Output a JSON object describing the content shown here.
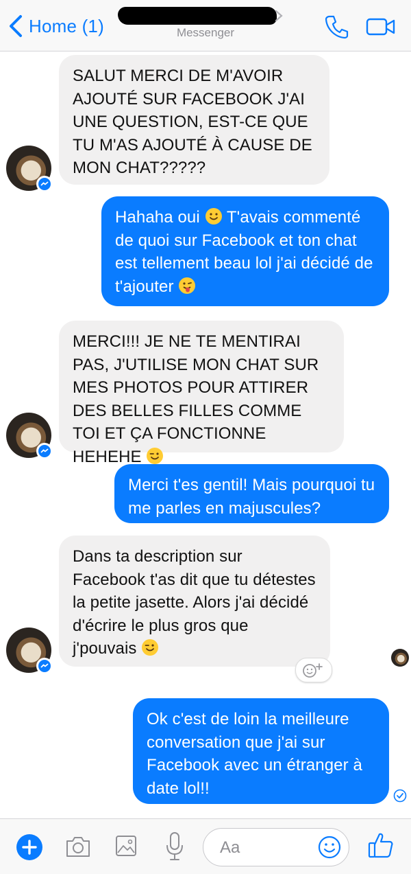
{
  "header": {
    "back_label": "Home (1)",
    "subtitle": "Messenger",
    "accent_color": "#0a7cff",
    "icons": [
      "chevron-left-icon",
      "phone-icon",
      "video-camera-icon"
    ]
  },
  "messages": [
    {
      "direction": "incoming",
      "text": "SALUT MERCI DE M'AVOIR AJOUTÉ SUR FACEBOOK J'AI UNE QUESTION, EST-CE QUE TU M'AS AJOUTÉ À CAUSE DE MON CHAT?????"
    },
    {
      "direction": "outgoing",
      "text": "Hahaha oui",
      "text_b": "T'avais commenté de quoi sur Facebook et ton chat est tellement beau lol j'ai décidé de t'ajouter"
    },
    {
      "direction": "incoming",
      "text": "MERCI!!! JE NE TE MENTIRAI PAS, J'UTILISE MON CHAT SUR MES PHOTOS POUR ATTIRER DES BELLES FILLES COMME TOI ET ÇA FONCTIONNE HEHEHE"
    },
    {
      "direction": "outgoing",
      "text": "Merci t'es gentil! Mais pourquoi tu me parles en majuscules?"
    },
    {
      "direction": "incoming",
      "text": "Dans ta description sur Facebook t'as dit que tu détestes la petite jasette. Alors j'ai décidé d'écrire le plus gros que j'pouvais"
    },
    {
      "direction": "outgoing",
      "text": "Ok c'est de loin la meilleure conversation que j'ai sur Facebook avec un étranger à date lol!!"
    }
  ],
  "composer": {
    "placeholder": "Aa",
    "icons": [
      "plus-icon",
      "camera-icon",
      "photo-icon",
      "microphone-icon",
      "smiley-icon",
      "thumbs-up-icon"
    ]
  },
  "colors": {
    "incoming_bubble": "#f1f0f0",
    "outgoing_bubble": "#0a7cff",
    "header_bg": "#f8f8f8"
  }
}
